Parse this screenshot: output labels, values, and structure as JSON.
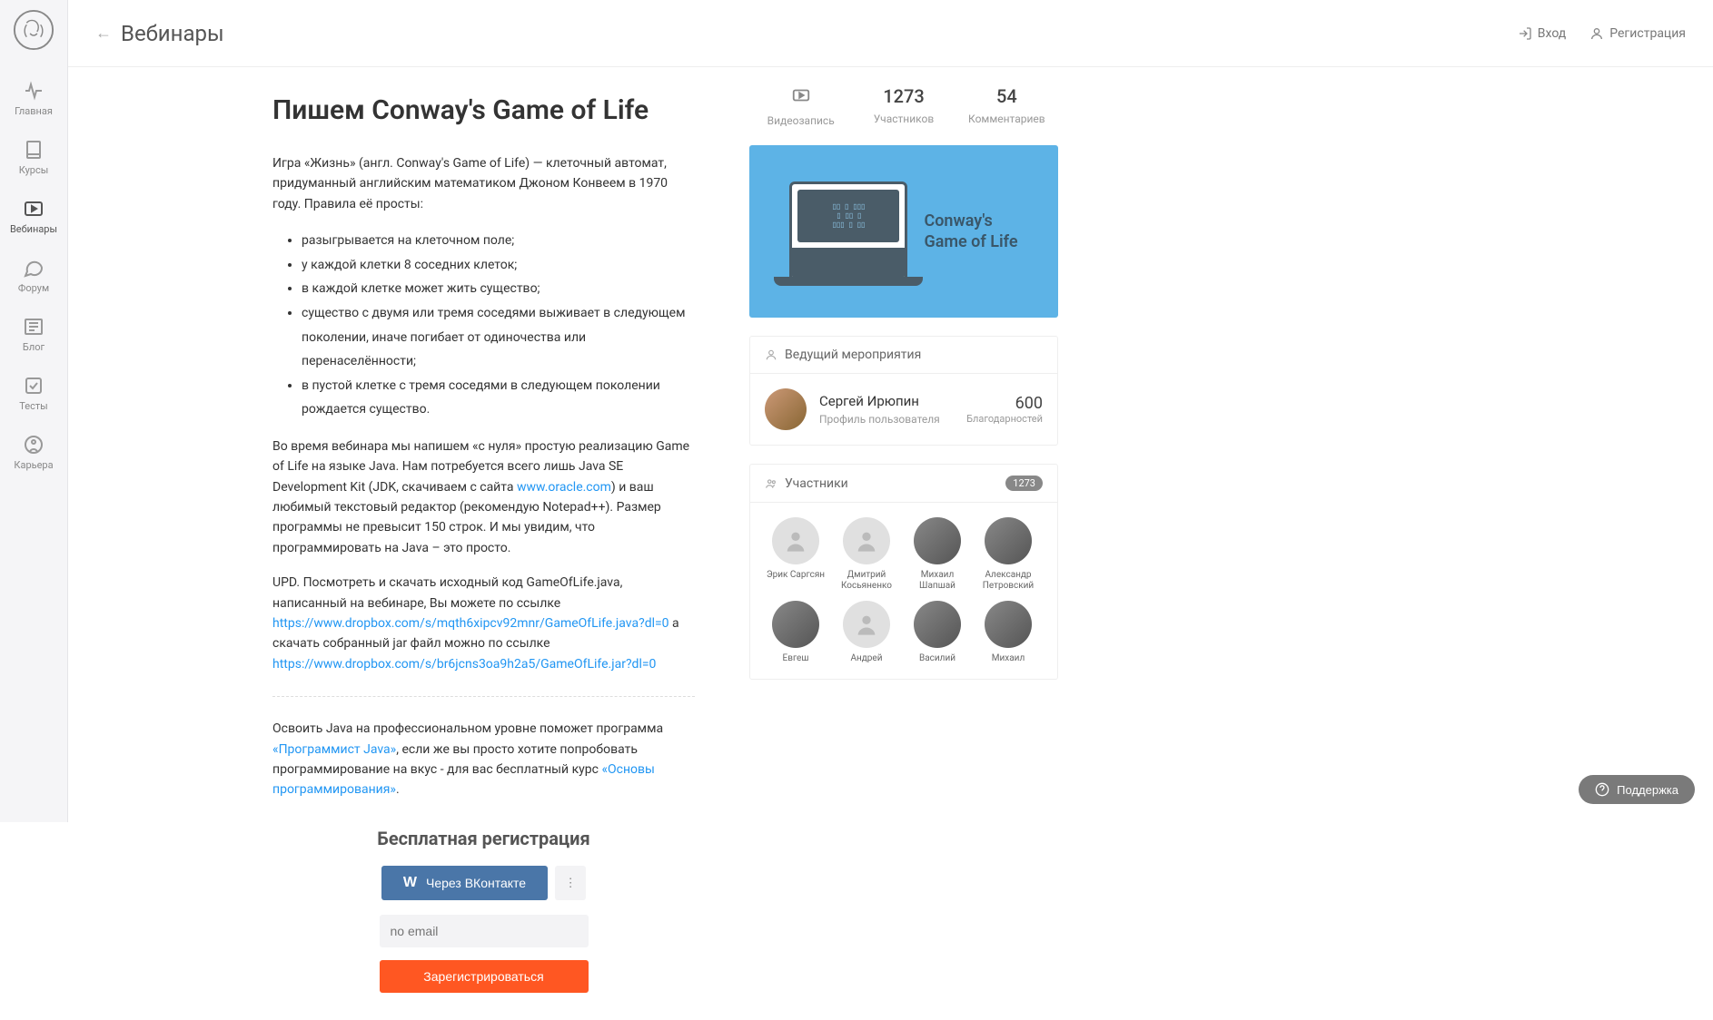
{
  "sidebar": {
    "items": [
      {
        "label": "Главная"
      },
      {
        "label": "Курсы"
      },
      {
        "label": "Вебинары"
      },
      {
        "label": "Форум"
      },
      {
        "label": "Блог"
      },
      {
        "label": "Тесты"
      },
      {
        "label": "Карьера"
      }
    ]
  },
  "header": {
    "breadcrumb": "Вебинары",
    "login": "Вход",
    "register": "Регистрация"
  },
  "article": {
    "title": "Пишем Conway's Game of Life",
    "intro": "Игра «Жизнь» (англ. Conway's Game of Life) — клеточный автомат, придуманный английским математиком Джоном Конвеем в 1970 году. Правила её просты:",
    "rules": [
      "разыгрывается на клеточном поле;",
      "у каждой клетки 8 соседних клеток;",
      "в каждой клетке может жить существо;",
      "существо с двумя или тремя соседями выживает в следующем поколении, иначе погибает от одиночества или перенаселённости;",
      "в пустой клетке с тремя соседями в следующем поколении рождается существо."
    ],
    "para2a": "Во время вебинара мы напишем «с нуля» простую реализацию Game of Life на языке Java. Нам потребуется всего лишь Java SE Development Kit (JDK, скачиваем с сайта ",
    "oracle_link": "www.oracle.com",
    "para2b": ") и ваш любимый текстовый редактор (рекомендую Notepad++). Размер программы не превысит 150 строк. И мы увидим, что программировать на Java – это просто.",
    "para3a": "UPD. Посмотреть и скачать исходный код GameOfLife.java, написанный на вебинаре, Вы можете по ссылке ",
    "link1": "https://www.dropbox.com/s/mqth6xipcv92mnr/GameOfLife.java?dl=0",
    "para3b": " а скачать собранный jar файл можно по ссылке ",
    "link2": "https://www.dropbox.com/s/br6jcns3oa9h2a5/GameOfLife.jar?dl=0",
    "para4a": "Освоить Java на профессиональном уровне поможет программа ",
    "course_link1": "«Программист Java»",
    "para4b": ", если же вы просто хотите попробовать программирование на вкус - для вас бесплатный курс ",
    "course_link2": "«Основы программирования»",
    "para4c": "."
  },
  "registration": {
    "title": "Бесплатная регистрация",
    "vk_label": "Через ВКонтакте",
    "email_placeholder": "no email",
    "submit": "Зарегистрироваться"
  },
  "stats": {
    "video_label": "Видеозапись",
    "participants_count": "1273",
    "participants_label": "Участников",
    "comments_count": "54",
    "comments_label": "Комментариев"
  },
  "thumb": {
    "title_line1": "Conway's",
    "title_line2": "Game of Life"
  },
  "host_section": {
    "header": "Ведущий мероприятия",
    "name": "Сергей Ирюпин",
    "sub": "Профиль пользователя",
    "thanks_num": "600",
    "thanks_label": "Благодарностей"
  },
  "participants_section": {
    "header": "Участники",
    "badge": "1273",
    "items": [
      {
        "name": "Эрик Саргсян",
        "photo": false
      },
      {
        "name": "Дмитрий Косьяненко",
        "photo": false
      },
      {
        "name": "Михаил Шапшай",
        "photo": true
      },
      {
        "name": "Александр Петровский",
        "photo": true
      },
      {
        "name": "Евгеш",
        "photo": true
      },
      {
        "name": "Андрей",
        "photo": false
      },
      {
        "name": "Василий",
        "photo": true
      },
      {
        "name": "Михаил",
        "photo": true
      }
    ]
  },
  "support": "Поддержка"
}
